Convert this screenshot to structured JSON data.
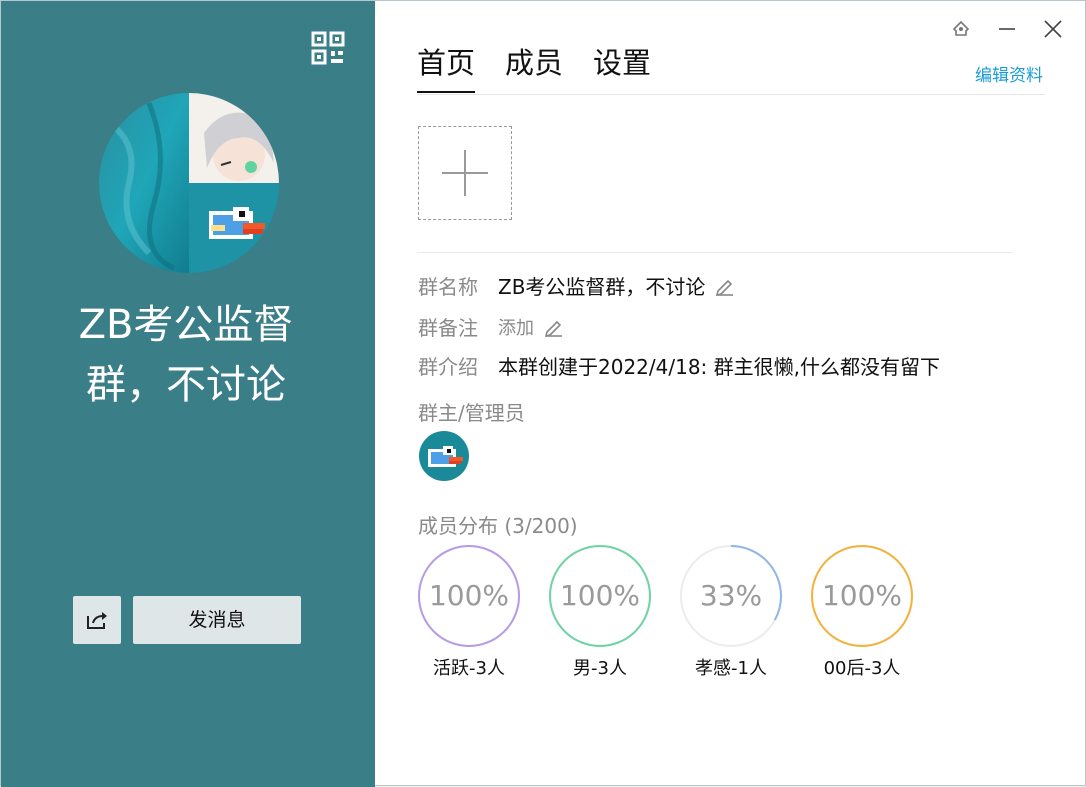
{
  "left_panel": {
    "group_name_line1": "ZB考公监督",
    "group_name_line2": "群，不讨论",
    "send_button_label": "发消息",
    "background_color": "#3a7e88"
  },
  "tabs": [
    {
      "label": "首页",
      "active": true
    },
    {
      "label": "成员",
      "active": false
    },
    {
      "label": "设置",
      "active": false
    }
  ],
  "edit_link": "编辑资料",
  "info": {
    "name_label": "群名称",
    "name_value": "ZB考公监督群，不讨论",
    "remark_label": "群备注",
    "remark_value": "添加",
    "intro_label": "群介绍",
    "intro_value": "本群创建于2022/4/18:  群主很懒,什么都没有留下"
  },
  "admins_label": "群主/管理员",
  "distribution": {
    "label": "成员分布",
    "count": "(3/200)",
    "stats": [
      {
        "percent_text": "100%",
        "fraction": 1.0,
        "label": "活跃-3人",
        "color": "#b79be6"
      },
      {
        "percent_text": "100%",
        "fraction": 1.0,
        "label": "男-3人",
        "color": "#6fd3a4"
      },
      {
        "percent_text": "33%",
        "fraction": 0.33,
        "label": "孝感-1人",
        "color": "#8fb6e6"
      },
      {
        "percent_text": "100%",
        "fraction": 1.0,
        "label": "00后-3人",
        "color": "#f3b23c"
      }
    ]
  },
  "icons": {
    "qr": "qr-code-icon",
    "share": "share-icon",
    "pin": "pin-icon",
    "minimize": "minimize-icon",
    "close": "close-icon",
    "pencil": "pencil-icon",
    "plus": "plus-icon"
  },
  "accent_color": "#1a9cd8"
}
